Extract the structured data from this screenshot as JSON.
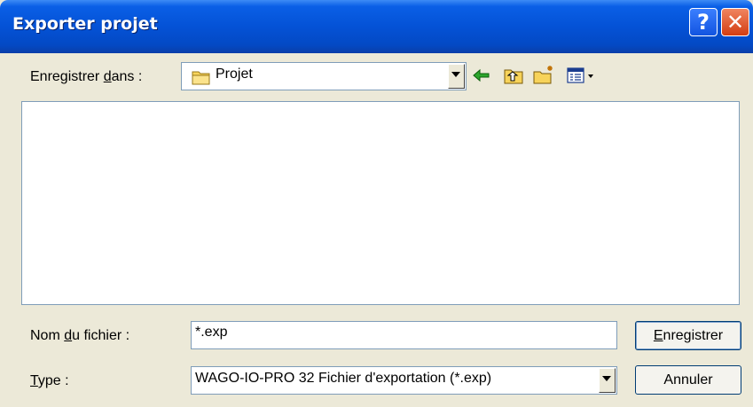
{
  "dialog": {
    "title": "Exporter projet",
    "help_label": "?",
    "close_label": "✕"
  },
  "save_in": {
    "label_pre": "Enregistrer ",
    "label_u": "d",
    "label_post": "ans :",
    "folder": "Projet"
  },
  "toolbar": {
    "icons": [
      "back-arrow-icon",
      "up-one-level-icon",
      "new-folder-icon",
      "view-menu-icon"
    ]
  },
  "filename": {
    "label_pre": "Nom ",
    "label_u": "d",
    "label_post": "u fichier :",
    "value": "*.exp"
  },
  "type": {
    "label_u": "T",
    "label_post": "ype :",
    "selected": "WAGO-IO-PRO 32 Fichier d'exportation (*.exp)"
  },
  "buttons": {
    "save_u": "E",
    "save_rest": "nregistrer",
    "cancel": "Annuler"
  },
  "colors": {
    "titlebar": "#0452d6",
    "dialog_bg": "#ece9d8",
    "accent_green_arrow": "#1a9a1a"
  }
}
